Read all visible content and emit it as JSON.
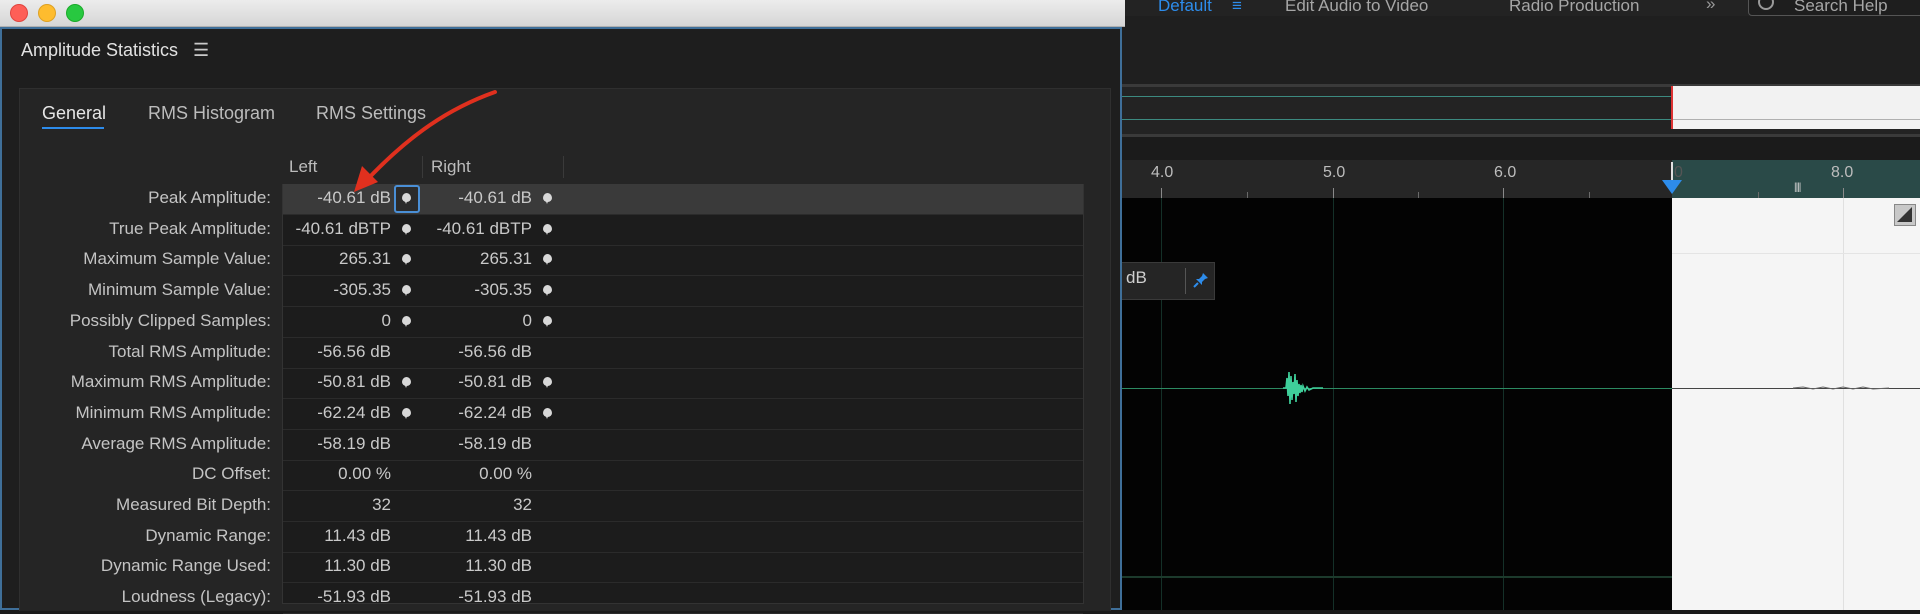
{
  "window": {
    "panel_title": "Amplitude Statistics",
    "panel_menu_icon": "hamburger-icon"
  },
  "tabs": [
    {
      "label": "General",
      "active": true
    },
    {
      "label": "RMS Histogram",
      "active": false
    },
    {
      "label": "RMS Settings",
      "active": false
    }
  ],
  "columns": {
    "left": "Left",
    "right": "Right"
  },
  "rows": [
    {
      "label": "Peak Amplitude:",
      "left": "-40.61 dB",
      "right": "-40.61 dB",
      "locate": true,
      "selected": true
    },
    {
      "label": "True Peak Amplitude:",
      "left": "-40.61 dBTP",
      "right": "-40.61 dBTP",
      "locate": true
    },
    {
      "label": "Maximum Sample Value:",
      "left": "265.31",
      "right": "265.31",
      "locate": true
    },
    {
      "label": "Minimum Sample Value:",
      "left": "-305.35",
      "right": "-305.35",
      "locate": true
    },
    {
      "label": "Possibly Clipped Samples:",
      "left": "0",
      "right": "0",
      "locate": true
    },
    {
      "label": "Total RMS Amplitude:",
      "left": "-56.56 dB",
      "right": "-56.56 dB",
      "locate": false
    },
    {
      "label": "Maximum RMS Amplitude:",
      "left": "-50.81 dB",
      "right": "-50.81 dB",
      "locate": true
    },
    {
      "label": "Minimum RMS Amplitude:",
      "left": "-62.24 dB",
      "right": "-62.24 dB",
      "locate": true
    },
    {
      "label": "Average RMS Amplitude:",
      "left": "-58.19 dB",
      "right": "-58.19 dB",
      "locate": false
    },
    {
      "label": "DC Offset:",
      "left": "0.00 %",
      "right": "0.00 %",
      "locate": false
    },
    {
      "label": "Measured Bit Depth:",
      "left": "32",
      "right": "32",
      "locate": false
    },
    {
      "label": "Dynamic Range:",
      "left": "11.43 dB",
      "right": "11.43 dB",
      "locate": false
    },
    {
      "label": "Dynamic Range Used:",
      "left": "11.30 dB",
      "right": "11.30 dB",
      "locate": false
    },
    {
      "label": "Loudness (Legacy):",
      "left": "-51.93 dB",
      "right": "-51.93 dB",
      "locate": false
    }
  ],
  "workspace": {
    "tabs": [
      "Default",
      "Edit Audio to Video",
      "Radio Production"
    ],
    "active_tab": "Default",
    "menu_icon": "hamburger-icon",
    "overflow_icon": "double-chevron-icon",
    "search_placeholder": "Search Help"
  },
  "ruler": {
    "labels": [
      "4.0",
      "5.0",
      "6.0",
      "0",
      "8.0"
    ]
  },
  "hud": {
    "value_text": "dB",
    "pin_icon": "pin-icon"
  },
  "colors": {
    "accent": "#2d8ceb",
    "waveform": "#3fcf9a",
    "playhead": "#dd3333",
    "annotation_arrow": "#e0301e"
  }
}
